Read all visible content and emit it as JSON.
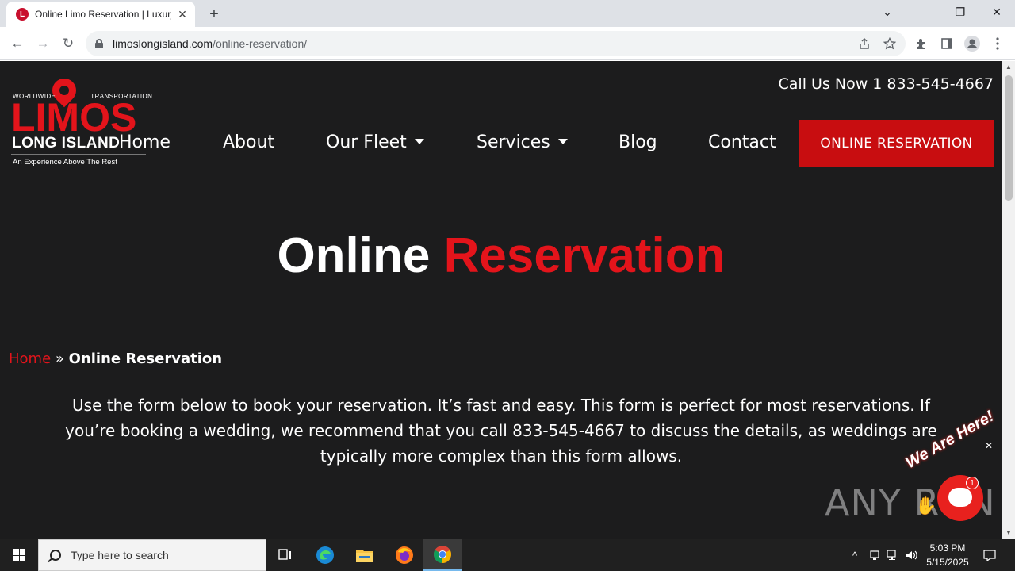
{
  "browser": {
    "tab": {
      "favicon_letter": "L",
      "title": "Online Limo Reservation | Luxury",
      "close": "✕"
    },
    "new_tab": "+",
    "window": {
      "minimize": "—",
      "restore": "❐",
      "close": "✕",
      "tab_search": "⌄"
    },
    "address": {
      "host": "limoslongisland.com",
      "path": "/online-reservation/"
    },
    "nav": {
      "back": "←",
      "forward": "→",
      "reload": "↻"
    }
  },
  "site": {
    "logo": {
      "top_left": "WORLDWIDE",
      "top_right": "TRANSPORTATION",
      "main": "LIMOS",
      "sub": "LONG ISLAND",
      "tagline": "An Experience Above The Rest"
    },
    "call": "Call Us Now 1 833-545-4667",
    "menu": {
      "home": "Home",
      "about": "About",
      "fleet": "Our Fleet",
      "services": "Services",
      "blog": "Blog",
      "contact": "Contact"
    },
    "cta": "ONLINE RESERVATION",
    "hero": {
      "white": "Online",
      "red": "Reservation"
    },
    "breadcrumb": {
      "home": "Home",
      "sep": "»",
      "current": "Online Reservation"
    },
    "intro": "Use the form below to book your reservation. It’s fast and easy. This form is perfect for most reservations. If you’re booking a wedding, we recommend that you call 833-545-4667 to discuss the details, as weddings are typically more complex than this form allows.",
    "chat": {
      "label": "We Are Here!",
      "badge": "1",
      "close": "✕"
    }
  },
  "watermark": "ANY RUN",
  "taskbar": {
    "search_placeholder": "Type here to search",
    "time": "5:03 PM",
    "date": "5/15/2025"
  }
}
